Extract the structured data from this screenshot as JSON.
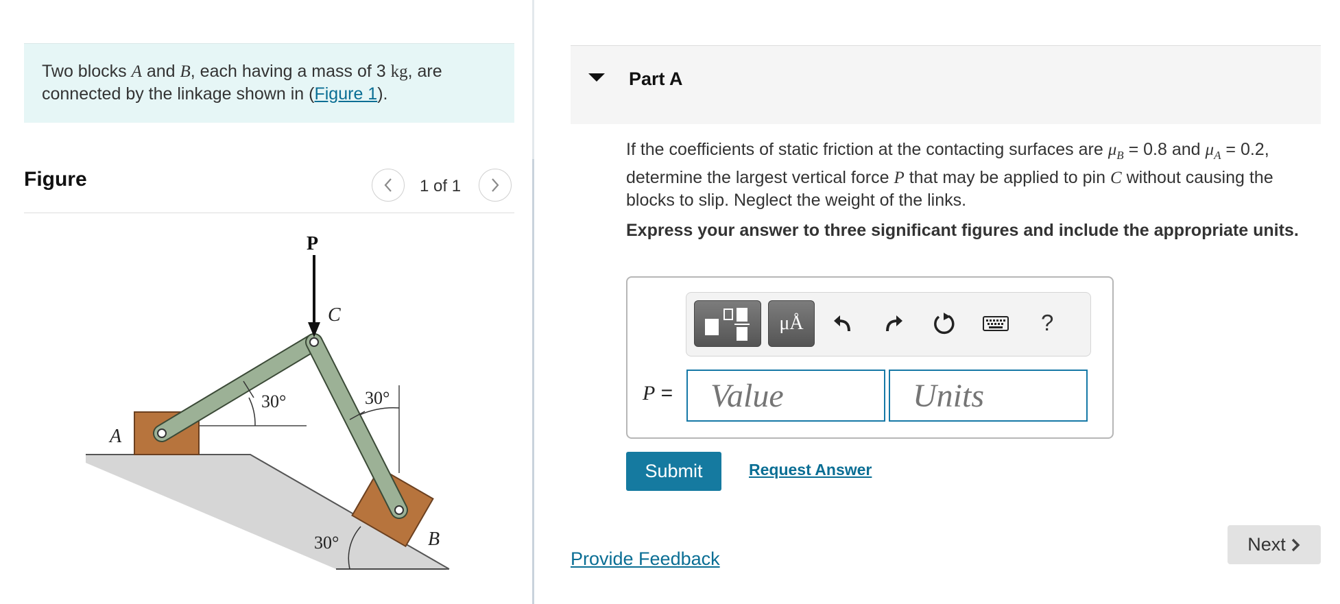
{
  "intro": {
    "text_before_a": "Two blocks ",
    "var_a": "A",
    "text_and": " and ",
    "var_b": "B",
    "text_mass": ", each having a mass of 3 ",
    "unit_kg": "kg",
    "text_after_kg": ", are connected by the linkage shown in (",
    "figure_link": "Figure 1",
    "text_end": ")."
  },
  "figure": {
    "title": "Figure",
    "prev_icon": "chevron-left-icon",
    "next_icon": "chevron-right-icon",
    "pager": "1 of 1",
    "labels": {
      "force": "P",
      "pin": "C",
      "block_a": "A",
      "block_b": "B",
      "angle_link_ac": "30°",
      "angle_link_bc": "30°",
      "angle_incline": "30°"
    },
    "colors": {
      "link": "#9cb196",
      "block": "#b7743d",
      "ground": "#d7d7d7"
    }
  },
  "part": {
    "caret_icon": "caret-down-icon",
    "title": "Part A",
    "question": {
      "t1": "If the coefficients of static friction at the contacting surfaces are ",
      "mu_b_base": "μ",
      "mu_b_sub": "B",
      "t2": " = 0.8 and ",
      "mu_a_base": "μ",
      "mu_a_sub": "A",
      "t3": " = 0.2, determine the largest vertical force ",
      "var_p": "P",
      "t4": " that may be applied to pin ",
      "var_c": "C",
      "t5": " without causing the blocks to slip. Neglect the weight of the links."
    },
    "instruction": "Express your answer to three significant figures and include the appropriate units."
  },
  "toolbar": {
    "templates_icon": "fraction-template-icon",
    "units_label": "μÅ",
    "undo_icon": "undo-icon",
    "redo_icon": "redo-icon",
    "reset_icon": "reset-icon",
    "keyboard_icon": "keyboard-icon",
    "help_label": "?"
  },
  "answer": {
    "var": "P",
    "equals": " =",
    "value_placeholder": "Value",
    "units_placeholder": "Units"
  },
  "actions": {
    "submit": "Submit",
    "request_answer": "Request Answer",
    "feedback": "Provide Feedback",
    "next": "Next"
  },
  "colors": {
    "accent": "#157aa0",
    "link": "#0a6e94",
    "intro_bg": "#e6f6f6"
  }
}
